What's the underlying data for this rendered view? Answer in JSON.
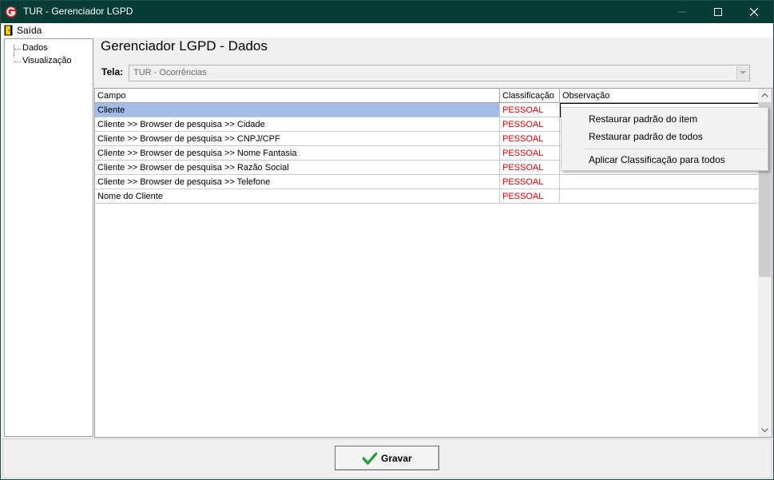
{
  "window": {
    "title": "TUR - Gerenciador LGPD"
  },
  "menubar": {
    "items": [
      {
        "label": "Saída",
        "icon": "exit-door-icon"
      }
    ]
  },
  "tree": {
    "items": [
      {
        "label": "Dados"
      },
      {
        "label": "Visualização"
      }
    ]
  },
  "page": {
    "title": "Gerenciador LGPD - Dados"
  },
  "screen_selector": {
    "label": "Tela:",
    "value": "TUR - Ocorrências"
  },
  "grid": {
    "columns": [
      "Campo",
      "Classificação",
      "Observação"
    ],
    "rows": [
      {
        "campo": "Cliente",
        "classificacao": "PESSOAL",
        "observacao": ""
      },
      {
        "campo": "Cliente >> Browser de pesquisa >> Cidade",
        "classificacao": "PESSOAL",
        "observacao": ""
      },
      {
        "campo": "Cliente >> Browser de pesquisa >> CNPJ/CPF",
        "classificacao": "PESSOAL",
        "observacao": ""
      },
      {
        "campo": "Cliente >> Browser de pesquisa >> Nome Fantasia",
        "classificacao": "PESSOAL",
        "observacao": ""
      },
      {
        "campo": "Cliente >> Browser de pesquisa >> Razão Social",
        "classificacao": "PESSOAL",
        "observacao": ""
      },
      {
        "campo": "Cliente >> Browser de pesquisa >> Telefone",
        "classificacao": "PESSOAL",
        "observacao": ""
      },
      {
        "campo": "Nome do Cliente",
        "classificacao": "PESSOAL",
        "observacao": ""
      }
    ]
  },
  "context_menu": {
    "items": [
      "Restaurar padrão do item",
      "Restaurar padrão de todos",
      "Aplicar Classificação para todos"
    ]
  },
  "footer": {
    "save_button": {
      "label": "Gravar",
      "icon": "checkmark-icon"
    }
  },
  "colors": {
    "titlebar": "#053d35",
    "selection": "#a4bce8",
    "classification_text": "#e00000",
    "checkmark": "#1c9c2a",
    "app_icon": "#d0202a"
  }
}
